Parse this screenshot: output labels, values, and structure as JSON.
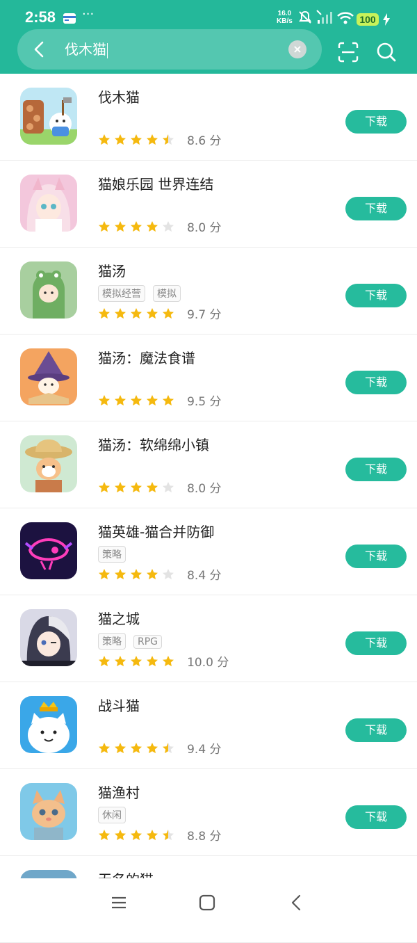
{
  "status": {
    "time": "2:58",
    "net_speed_value": "16.0",
    "net_speed_unit": "KB/s",
    "battery": "100",
    "dots": "···"
  },
  "search": {
    "query": "伐木猫",
    "clear_label": "×"
  },
  "apps": [
    {
      "name": "伐木猫",
      "tags": [],
      "stars": 4.5,
      "score": "8.6 分",
      "button": "下载"
    },
    {
      "name": "猫娘乐园 世界连结",
      "tags": [],
      "stars": 4,
      "score": "8.0 分",
      "button": "下载"
    },
    {
      "name": "猫汤",
      "tags": [
        "模拟经营",
        "模拟"
      ],
      "stars": 5,
      "score": "9.7 分",
      "button": "下载"
    },
    {
      "name": "猫汤：魔法食谱",
      "tags": [],
      "stars": 5,
      "score": "9.5 分",
      "button": "下载"
    },
    {
      "name": "猫汤：软绵绵小镇",
      "tags": [],
      "stars": 4,
      "score": "8.0 分",
      "button": "下载"
    },
    {
      "name": "猫英雄-猫合并防御",
      "tags": [
        "策略"
      ],
      "stars": 4,
      "score": "8.4 分",
      "button": "下载"
    },
    {
      "name": "猫之城",
      "tags": [
        "策略",
        "RPG"
      ],
      "stars": 5,
      "score": "10.0 分",
      "button": "下载"
    },
    {
      "name": "战斗猫",
      "tags": [],
      "stars": 4.5,
      "score": "9.4 分",
      "button": "下载"
    },
    {
      "name": "猫渔村",
      "tags": [
        "休闲"
      ],
      "stars": 4.5,
      "score": "8.8 分",
      "button": "下载"
    },
    {
      "name": "无名的猫",
      "tags": [],
      "stars": null,
      "score": "",
      "button": ""
    }
  ],
  "colors": {
    "accent": "#24b89a",
    "button": "#26bb9d",
    "star": "#f5b90f",
    "star_empty": "#e3e3e3"
  }
}
